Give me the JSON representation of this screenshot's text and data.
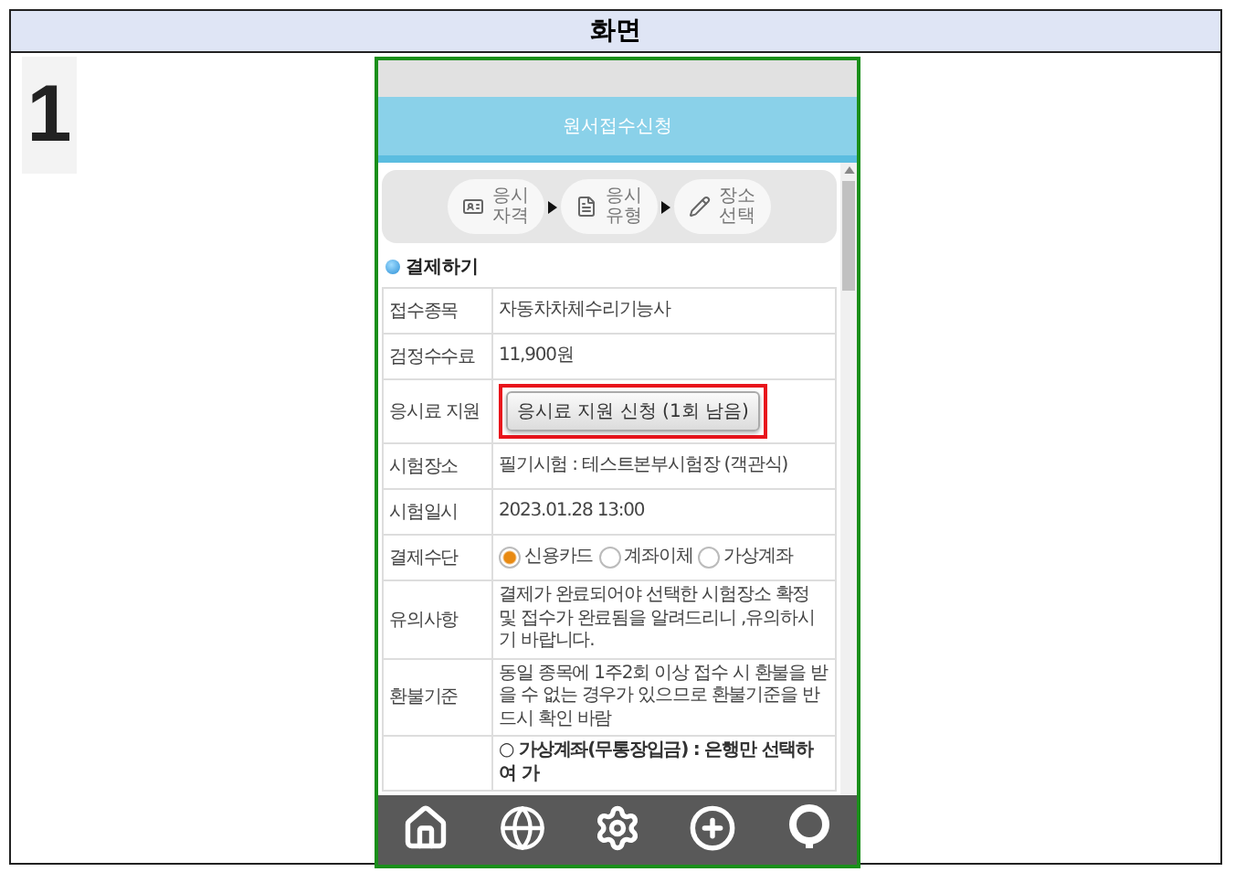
{
  "sheet": {
    "header": "화면",
    "row_number": "1"
  },
  "phone": {
    "title": "원서접수신청",
    "steps": [
      {
        "label": "응시 자격"
      },
      {
        "label": "응시 유형"
      },
      {
        "label": "장소 선택"
      }
    ],
    "section_title": "결제하기",
    "rows": [
      {
        "kind": "text",
        "label": "접수종목",
        "value": "자동차차체수리기능사"
      },
      {
        "kind": "text",
        "label": "검정수수료",
        "value": "11,900원"
      },
      {
        "kind": "button",
        "label": "응시료 지원",
        "value": "응시료 지원 신청 (1회 남음)",
        "highlighted": true
      },
      {
        "kind": "text",
        "label": "시험장소",
        "value": "필기시험 : 테스트본부시험장 (객관식)"
      },
      {
        "kind": "text",
        "label": "시험일시",
        "value": "2023.01.28 13:00"
      },
      {
        "kind": "radio",
        "label": "결제수단",
        "options": [
          {
            "label": "신용카드",
            "selected": true
          },
          {
            "label": "계좌이체",
            "selected": false
          },
          {
            "label": "가상계좌",
            "selected": false
          }
        ]
      },
      {
        "kind": "text",
        "label": "유의사항",
        "value": "결제가 완료되어야 선택한 시험장소 확정 및 접수가 완료됨을 알려드리니 ,유의하시기 바랍니다."
      },
      {
        "kind": "text",
        "label": "환불기준",
        "value": "동일 종목에 1주2회 이상 접수 시 환불을 받을 수 없는 경우가 있으므로 환불기준을 반드시 확인 바람"
      },
      {
        "kind": "bold",
        "label": "",
        "value": "○ 가상계좌(무통장입금) : 은행만 선택하여 가"
      }
    ]
  }
}
